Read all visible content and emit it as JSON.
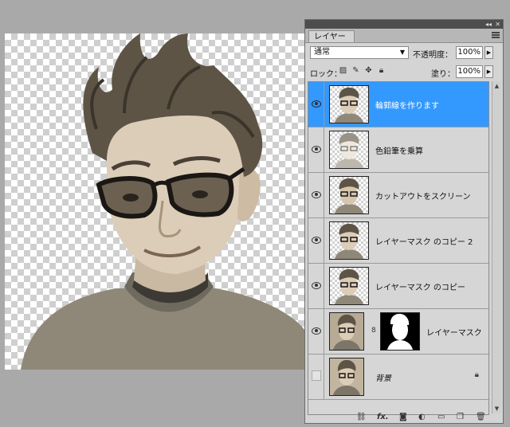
{
  "panel": {
    "tab_label": "レイヤー",
    "blend_mode": "通常",
    "opacity_label": "不透明度：",
    "opacity_value": "100%",
    "lock_label": "ロック：",
    "fill_label": "塗り：",
    "fill_value": "100%",
    "layers": [
      {
        "name": "輪郭線を作ります",
        "visible": true,
        "selected": true
      },
      {
        "name": "色鉛筆を乗算",
        "visible": true,
        "selected": false
      },
      {
        "name": "カットアウトをスクリーン",
        "visible": true,
        "selected": false
      },
      {
        "name": "レイヤーマスク のコピー 2",
        "visible": true,
        "selected": false
      },
      {
        "name": "レイヤーマスク のコピー",
        "visible": true,
        "selected": false
      },
      {
        "name": "レイヤーマスク",
        "visible": true,
        "selected": false,
        "has_mask": true
      },
      {
        "name": "背景",
        "visible": false,
        "selected": false,
        "locked": true
      }
    ],
    "footer_icons": [
      "link-icon",
      "fx-icon",
      "add-mask-icon",
      "adjustment-icon",
      "group-icon",
      "new-layer-icon",
      "trash-icon"
    ]
  },
  "colors": {
    "selection": "#3399ff",
    "panel_bg": "#d4d4d4",
    "workspace_bg": "#a9a9a9"
  }
}
